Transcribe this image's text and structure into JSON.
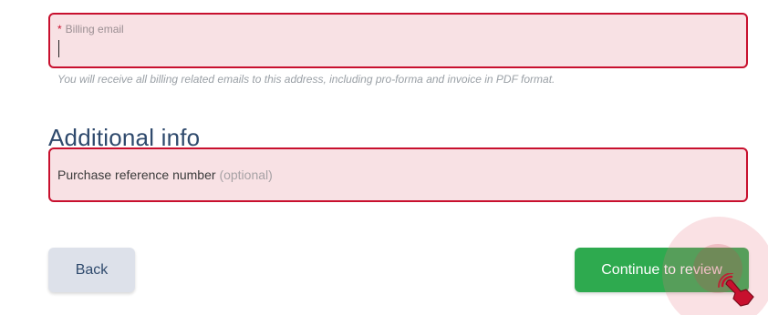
{
  "billing_email": {
    "required_mark": "*",
    "label": "Billing email",
    "value": "",
    "help_text": "You will receive all billing related emails to this address, including pro-forma and invoice in PDF format."
  },
  "additional_info": {
    "title": "Additional info",
    "purchase_reference": {
      "label": "Purchase reference number",
      "optional_text": "(optional)",
      "value": ""
    }
  },
  "actions": {
    "back_label": "Back",
    "continue_label": "Continue to review"
  },
  "colors": {
    "error_border": "#c8102e",
    "error_background": "#f8e1e4",
    "primary_button": "#2eaa4f",
    "secondary_button": "#dde1ea",
    "heading": "#2f4a6d"
  },
  "cursor": {
    "icon": "hand-pointer-click-icon"
  }
}
